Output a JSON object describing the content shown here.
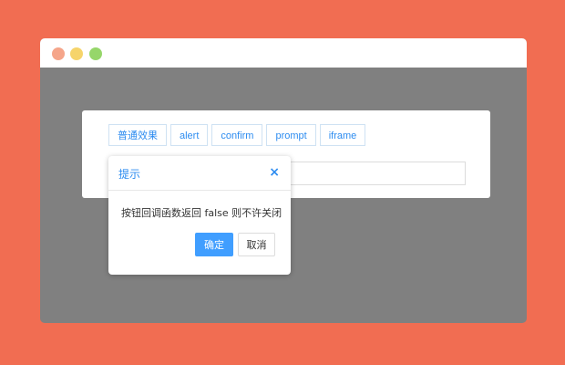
{
  "window": {
    "controls": [
      {
        "name": "close",
        "color": "#f5a58a"
      },
      {
        "name": "minimize",
        "color": "#f6d46b"
      },
      {
        "name": "maximize",
        "color": "#96d66a"
      }
    ]
  },
  "panel": {
    "buttons": [
      {
        "label": "普通效果"
      },
      {
        "label": "alert"
      },
      {
        "label": "confirm"
      },
      {
        "label": "prompt"
      },
      {
        "label": "iframe"
      }
    ],
    "input_value": ""
  },
  "dialog": {
    "title": "提示",
    "close_icon": "×",
    "message": "按钮回调函数返回 false 则不许关闭",
    "ok_label": "确定",
    "cancel_label": "取消"
  },
  "colors": {
    "page_background": "#f16d52",
    "overlay": "#808080",
    "accent": "#2d8cf0",
    "primary_button": "#409eff"
  }
}
